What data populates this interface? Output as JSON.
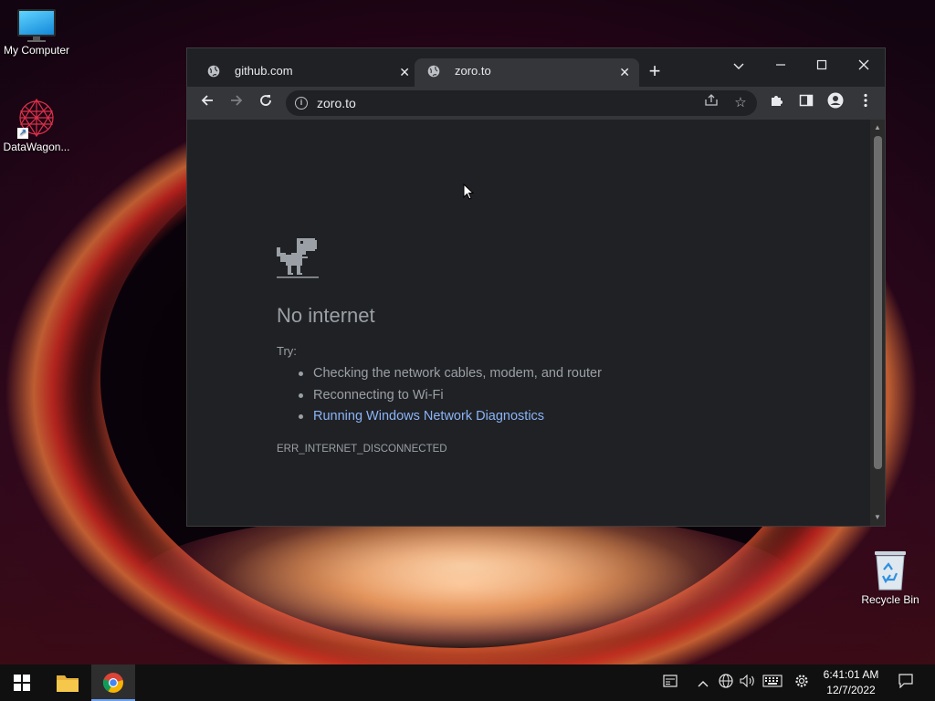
{
  "desktop": {
    "icons": [
      {
        "label": "My Computer"
      },
      {
        "label": "DataWagon..."
      },
      {
        "label": "Recycle Bin"
      }
    ]
  },
  "browser": {
    "tabs": [
      {
        "title": "github.com",
        "active": false
      },
      {
        "title": "zoro.to",
        "active": true
      }
    ],
    "new_tab_symbol": "+",
    "address": "zoro.to",
    "page": {
      "title": "No internet",
      "try_label": "Try:",
      "suggestions": [
        "Checking the network cables, modem, and router",
        "Reconnecting to Wi-Fi",
        "Running Windows Network Diagnostics"
      ],
      "error_code": "ERR_INTERNET_DISCONNECTED"
    }
  },
  "taskbar": {
    "time": "6:41:01 AM",
    "date": "12/7/2022"
  },
  "colors": {
    "browser_bg": "#202124",
    "toolbar_bg": "#35363a",
    "link": "#8ab4f8",
    "muted_text": "#9aa0a6"
  }
}
